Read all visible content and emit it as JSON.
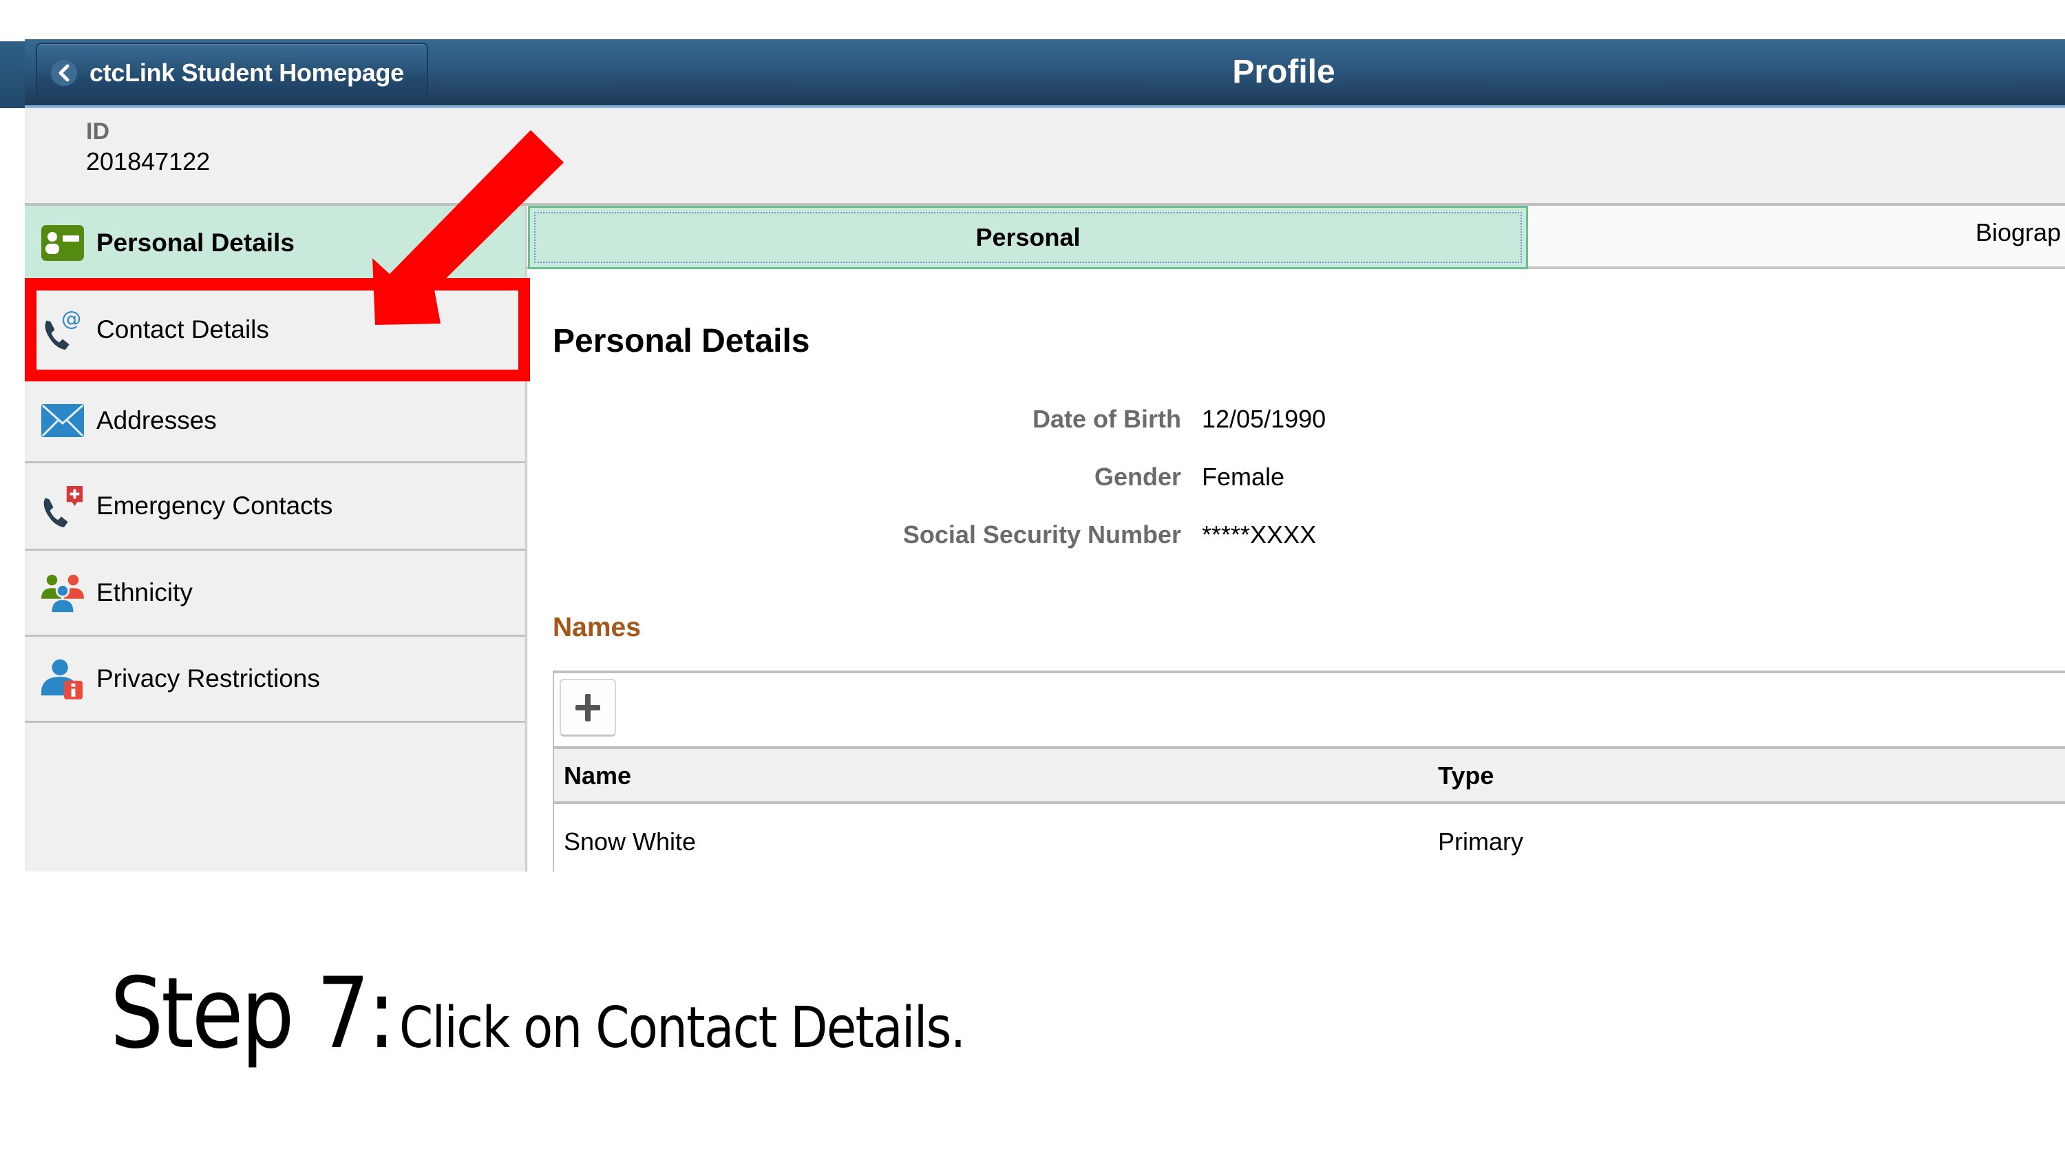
{
  "header": {
    "back_label": "ctcLink Student Homepage",
    "title": "Profile",
    "gradient_top": "#376a92",
    "gradient_bottom": "#1c3a58"
  },
  "id_block": {
    "label": "ID",
    "value": "201847122"
  },
  "sidebar": {
    "items": [
      {
        "label": "Personal Details",
        "icon": "id-card-icon",
        "active": true
      },
      {
        "label": "Contact Details",
        "icon": "phone-at-icon",
        "active": false,
        "highlighted": true
      },
      {
        "label": "Addresses",
        "icon": "envelope-icon",
        "active": false
      },
      {
        "label": "Emergency Contacts",
        "icon": "phone-medical-icon",
        "active": false
      },
      {
        "label": "Ethnicity",
        "icon": "people-group-icon",
        "active": false
      },
      {
        "label": "Privacy Restrictions",
        "icon": "user-info-icon",
        "active": false
      }
    ],
    "active_color": "#c9eada"
  },
  "tabs": [
    {
      "label": "Personal",
      "selected": true
    },
    {
      "label": "Biograp",
      "selected": false
    }
  ],
  "content": {
    "title": "Personal Details",
    "fields": [
      {
        "label": "Date of Birth",
        "value": "12/05/1990"
      },
      {
        "label": "Gender",
        "value": "Female"
      },
      {
        "label": "Social Security Number",
        "value": "*****XXXX"
      }
    ],
    "names_section": {
      "title": "Names",
      "title_color": "#a5561a",
      "add_icon": "plus-icon",
      "columns": [
        "Name",
        "Type"
      ],
      "rows": [
        [
          "Snow White",
          "Primary"
        ]
      ]
    }
  },
  "annotation": {
    "color": "#ff0000",
    "target": "Contact Details"
  },
  "caption": {
    "step": "Step 7:",
    "text": "Click on Contact Details."
  }
}
